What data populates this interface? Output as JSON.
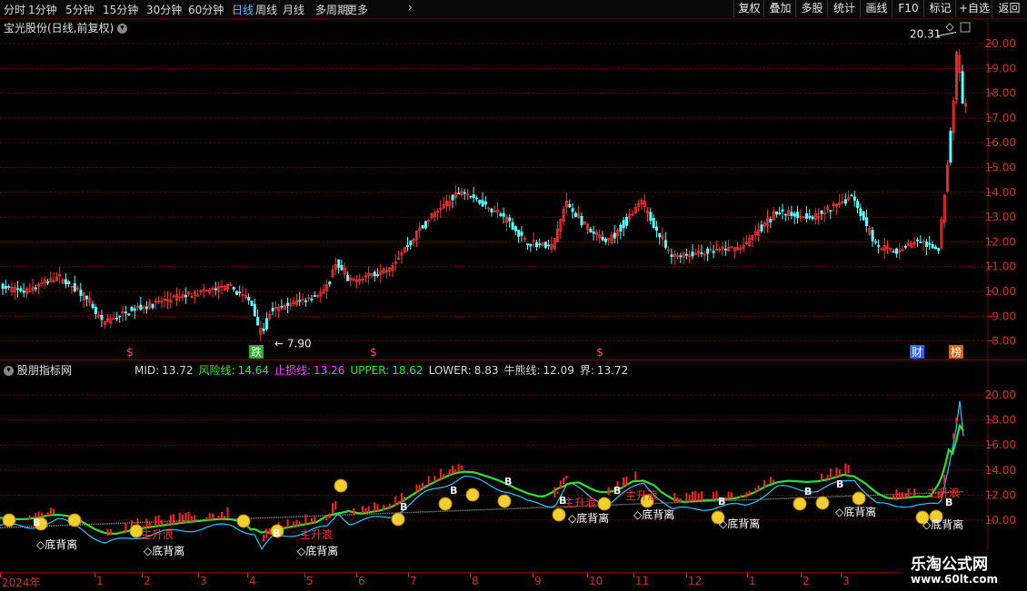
{
  "toolbar": {
    "periods": [
      "分时",
      "1分钟",
      "5分钟",
      "15分钟",
      "30分钟",
      "60分钟",
      "日线",
      "周线",
      "月线",
      "多周期",
      "更多"
    ],
    "active": "日线",
    "more_arrow": "›",
    "buttons": [
      "复权",
      "叠加",
      "多股",
      "统计",
      "画线",
      "F10",
      "标记",
      "+自选",
      "返回"
    ]
  },
  "main": {
    "title": "宝光股份(日线,前复权)",
    "y_ticks": [
      "20.00",
      "19.00",
      "18.00",
      "17.00",
      "16.00",
      "15.00",
      "14.00",
      "13.00",
      "12.00",
      "11.00",
      "10.00",
      "9.00",
      "8.00"
    ],
    "high_label": "20.31",
    "low_label": "7.90",
    "markers": [
      "$",
      "跌",
      "$",
      "$",
      "财",
      "榜"
    ]
  },
  "indicator": {
    "name": "股朋指标网",
    "legend": [
      {
        "k": "MID:",
        "v": "13.72",
        "color": "#d8d8d8"
      },
      {
        "k": "风险线:",
        "v": "14.64",
        "color": "#2ee82e"
      },
      {
        "k": "止损线:",
        "v": "13.26",
        "color": "#ff40ff"
      },
      {
        "k": "UPPER:",
        "v": "18.62",
        "color": "#2ee82e"
      },
      {
        "k": "LOWER:",
        "v": "8.83",
        "color": "#d8d8d8"
      },
      {
        "k": "牛熊线:",
        "v": "12.09",
        "color": "#d8d8d8"
      },
      {
        "k": "界:",
        "v": "13.72",
        "color": "#d8d8d8"
      }
    ],
    "y_ticks": [
      "20.00",
      "18.00",
      "16.00",
      "14.00",
      "12.00",
      "10.00"
    ],
    "signals": {
      "bottom": "◇底背离",
      "up": "主升浪",
      "b": "B"
    }
  },
  "x_axis": [
    "2024年",
    "1",
    "2",
    "3",
    "4",
    "5",
    "6",
    "7",
    "8",
    "9",
    "10",
    "11",
    "12",
    "1",
    "2",
    "3"
  ],
  "watermark": {
    "name": "乐淘公式网",
    "url": "www.60lt.com"
  },
  "colors": {
    "up": "#ff3232",
    "down": "#54ffff",
    "grid": "#7a0000",
    "axis": "#800000"
  }
}
